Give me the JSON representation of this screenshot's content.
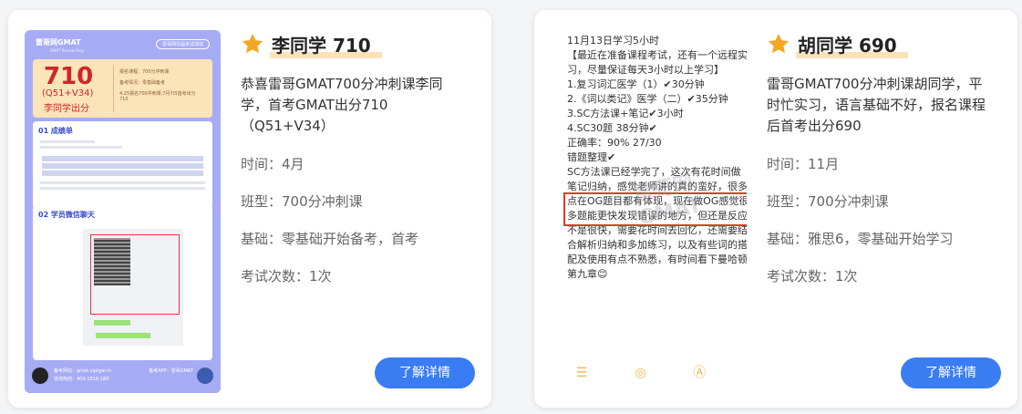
{
  "cards": [
    {
      "name": "李同学 710",
      "desc": "恭喜雷哥GMAT700分冲刺课李同学，首考GMAT出分710（Q51+V34）",
      "time": "时间：4月",
      "class_type": "班型：700分冲刺课",
      "basis": "基础：零基础开始备考，首考",
      "attempts": "考试次数：1次",
      "button": "了解详情",
      "poster": {
        "logo": "雷哥网GMAT",
        "logo_sub": "GMAT Review Prep",
        "tag": "雷哥网往届考试成绩",
        "score": "710",
        "qv": "(Q51+V34)",
        "student": "李同学出分",
        "class_line": "报名课程：700分冲刺课",
        "basis_line": "备考情况：零基础备考",
        "date_line": "4.25报名700冲刺课,7月7日首考出分710",
        "sec1": "01 成绩单",
        "sec2": "02 学员微信聊天",
        "site": "备考网站：gmat.viplgw.cn",
        "phone": "咨询热线：400-1816-180",
        "app": "备考APP：雷哥GMAT"
      }
    },
    {
      "name": "胡同学 690",
      "desc": "雷哥GMAT700分冲刺课胡同学，平时忙实习，语言基础不好，报名课程后首考出分690",
      "time": "时间：11月",
      "class_type": "班型：700分冲刺课",
      "basis": "基础：雅思6，零基础开始学习",
      "attempts": "考试次数：1次",
      "button": "了解详情",
      "notes": {
        "text": "11月13日学习5小时\n【最近在准备课程考试，还有一个远程实习，尽量保证每天3小时以上学习】\n1.复习词汇医学（1）✔30分钟\n2.《词以类记》医学（二）✔35分钟\n3.SC方法课+笔记✔3小时\n4.SC30题 38分钟✔\n   正确率：90% 27/30\n   错题整理✔\nSC方法课已经学完了，这次有花时间做笔记归纳，感觉老师讲的真的蛮好，很多点在OG题目都有体现，现在做OG感觉很多题能更快发现错误的地方，但还是反应不是很快，需要花时间去回忆，还需要结合解析归纳和多加练习，以及有些词的搭配及使用有点不熟悉，有时间看下曼哈顿第九章😊",
        "watermark": "雷哥网GMAT",
        "icon_list": "list-icon",
        "icon_camera": "camera-icon",
        "icon_pen": "pen-icon",
        "icon_edit": "edit-icon"
      }
    }
  ],
  "colors": {
    "accent": "#3a7cf2",
    "star": "#f5a623",
    "poster_bg": "#a6acf4",
    "score_red": "#d0252b"
  }
}
